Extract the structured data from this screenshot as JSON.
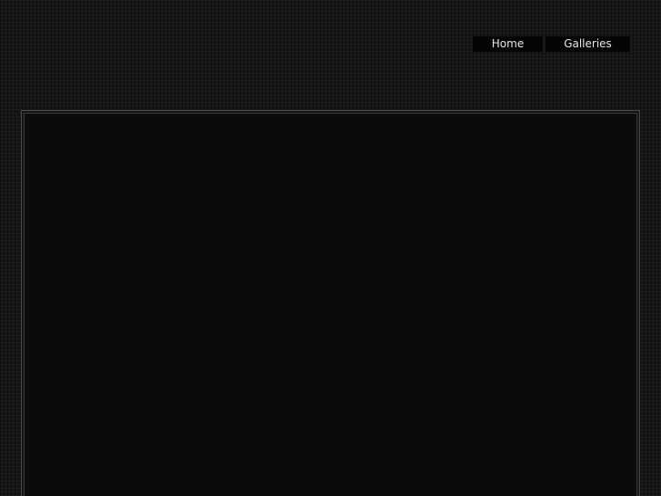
{
  "nav": {
    "items": [
      {
        "label": "Home"
      },
      {
        "label": "Galleries"
      }
    ]
  },
  "colors": {
    "background": "#161616",
    "nav_bg": "#050505",
    "nav_text": "#e8e8e8",
    "frame_border": "#4a4a4a",
    "content_bg": "#0b0b0a"
  }
}
